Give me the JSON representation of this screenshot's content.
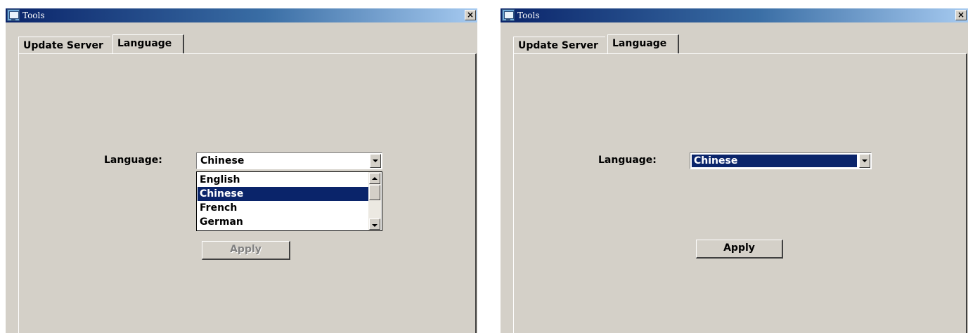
{
  "windows": [
    {
      "title": "Tools",
      "close_label": "×",
      "tabs": [
        {
          "label": "Update Server",
          "active": false
        },
        {
          "label": "Language",
          "active": true
        }
      ],
      "language_label": "Language:",
      "language_value": "Chinese",
      "dropdown_open": true,
      "dropdown_options": [
        "English",
        "Chinese",
        "French",
        "German"
      ],
      "highlighted_option": "Chinese",
      "apply_label": "Apply",
      "apply_enabled": false
    },
    {
      "title": "Tools",
      "close_label": "×",
      "tabs": [
        {
          "label": "Update Server",
          "active": false
        },
        {
          "label": "Language",
          "active": true
        }
      ],
      "language_label": "Language:",
      "language_value": "Chinese",
      "dropdown_open": false,
      "apply_label": "Apply",
      "apply_enabled": true
    }
  ],
  "colors": {
    "dialog_face": "#d4d0c8",
    "selection": "#0a246a",
    "titlebar_start": "#0a246a",
    "titlebar_end": "#a6caf0"
  },
  "icons": [
    "app-icon",
    "close-icon",
    "chevron-down-icon",
    "scroll-up-icon",
    "scroll-down-icon"
  ]
}
